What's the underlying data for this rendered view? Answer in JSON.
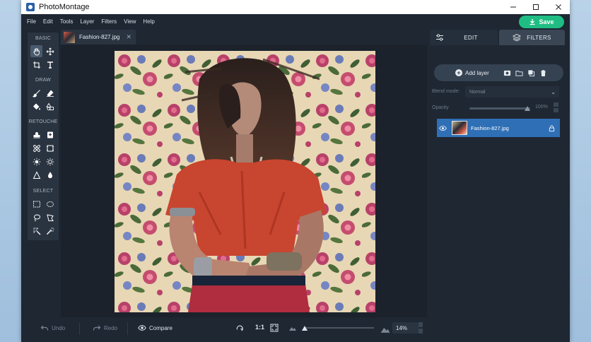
{
  "window": {
    "title": "PhotoMontage"
  },
  "menu": [
    "File",
    "Edit",
    "Tools",
    "Layer",
    "Filters",
    "View",
    "Help"
  ],
  "save_label": "Save",
  "tools": {
    "basic_label": "BASIC",
    "draw_label": "DRAW",
    "retouche_label": "RETOUCHE",
    "select_label": "SELECT"
  },
  "document_tab": {
    "label": "Fashion-827.jpg"
  },
  "right_panel": {
    "tabs": {
      "edit": "EDIT",
      "filters": "FILTERS"
    },
    "add_layer_label": "Add layer",
    "blend_mode_label": "Blend mode:",
    "blend_mode_value": "Normal",
    "opacity_label": "Opacity",
    "opacity_value": "100%",
    "opacity_fraction": 1.0,
    "layer_name": "Fashion-827.jpg"
  },
  "bottom": {
    "undo_label": "Undo",
    "redo_label": "Redo",
    "compare_label": "Compare",
    "one_to_one_label": "1:1",
    "zoom_value": "14%"
  },
  "colors": {
    "accent_save": "#1fbd84",
    "selected_layer": "#2f6fb5",
    "app_bg": "#1e2732"
  }
}
